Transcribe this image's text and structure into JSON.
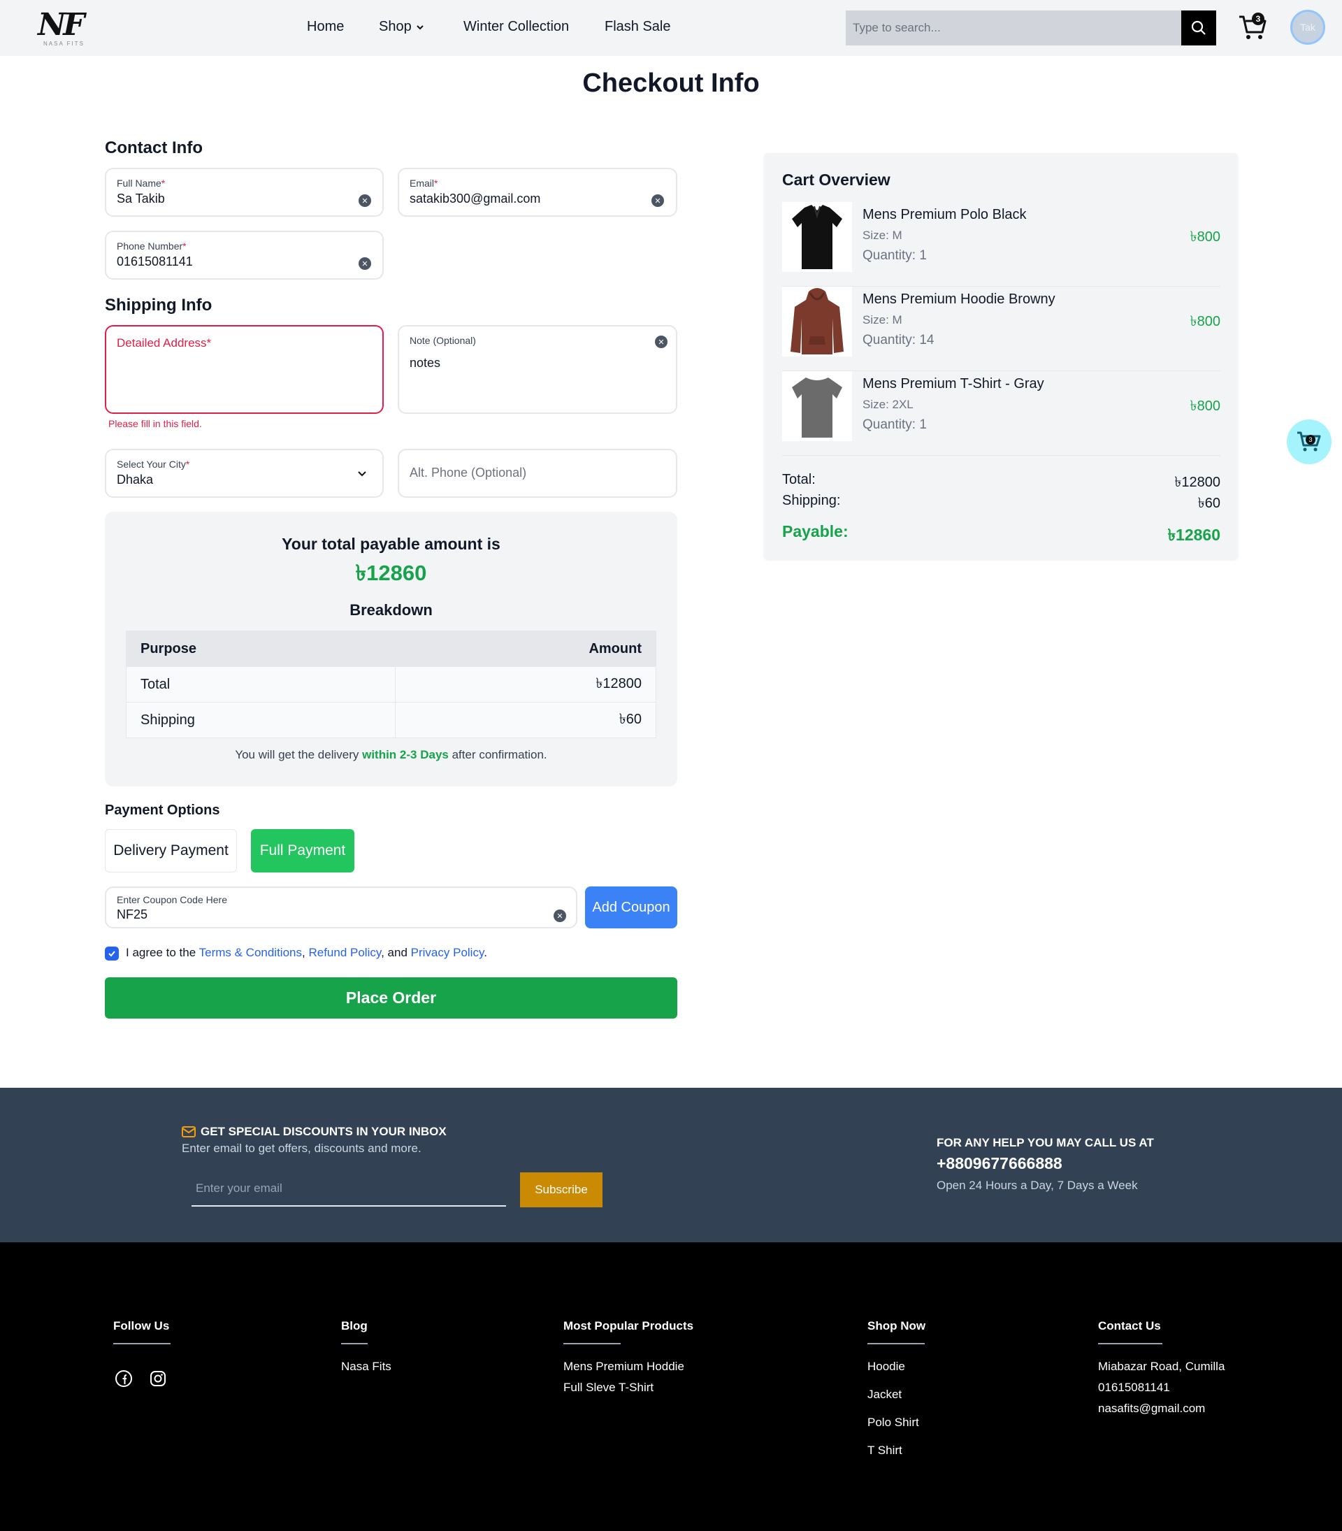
{
  "header": {
    "logo_text": "NF",
    "logo_subtext": "NASA FITS",
    "nav": [
      {
        "label": "Home"
      },
      {
        "label": "Shop"
      },
      {
        "label": "Winter Collection"
      },
      {
        "label": "Flash Sale"
      }
    ],
    "search_placeholder": "Type to search...",
    "cart_count": "3",
    "avatar_text": "Tak"
  },
  "page_title": "Checkout Info",
  "contact": {
    "title": "Contact Info",
    "full_name_label": "Full Name",
    "full_name_value": "Sa Takib",
    "email_label": "Email",
    "email_value": "satakib300@gmail.com",
    "phone_label": "Phone Number",
    "phone_value": "01615081141",
    "required_mark": "*"
  },
  "shipping": {
    "title": "Shipping Info",
    "address_label": "Detailed Address",
    "address_error": "Please fill in this field.",
    "note_label": "Note (Optional)",
    "note_value": "notes",
    "city_label": "Select Your City",
    "city_value": "Dhaka",
    "alt_phone_placeholder": "Alt. Phone (Optional)"
  },
  "summary": {
    "heading": "Your total payable amount is",
    "amount": "৳12860",
    "breakdown_title": "Breakdown",
    "col_purpose": "Purpose",
    "col_amount": "Amount",
    "rows": [
      {
        "purpose": "Total",
        "amount": "৳12800"
      },
      {
        "purpose": "Shipping",
        "amount": "৳60"
      }
    ],
    "delivery_prefix": "You will get the delivery",
    "delivery_highlight": "within 2-3 Days",
    "delivery_suffix": "after confirmation."
  },
  "payment": {
    "title": "Payment Options",
    "delivery_payment": "Delivery Payment",
    "full_payment": "Full Payment",
    "coupon_label": "Enter Coupon Code Here",
    "coupon_value": "NF25",
    "add_coupon": "Add Coupon"
  },
  "agreement": {
    "prefix": "I agree to the",
    "terms": "Terms & Conditions",
    "sep1": ",",
    "refund": "Refund Policy",
    "sep2": ", and",
    "privacy": "Privacy Policy",
    "end": "."
  },
  "place_order": "Place Order",
  "cart": {
    "title": "Cart Overview",
    "items": [
      {
        "name": "Mens Premium Polo Black",
        "size": "Size: M",
        "quantity": "Quantity: 1",
        "price": "৳800",
        "image": "black-polo-shirt",
        "color": "#111111"
      },
      {
        "name": "Mens Premium Hoodie Browny",
        "size": "Size: M",
        "quantity": "Quantity: 14",
        "price": "৳800",
        "image": "brown-hoodie",
        "color": "#7c3a2d"
      },
      {
        "name": "Mens Premium T-Shirt - Gray",
        "size": "Size: 2XL",
        "quantity": "Quantity: 1",
        "price": "৳800",
        "image": "gray-t-shirt",
        "color": "#6b6b6b"
      }
    ],
    "total_label": "Total:",
    "total_value": "৳12800",
    "shipping_label": "Shipping:",
    "shipping_value": "৳60",
    "payable_label": "Payable:",
    "payable_value": "৳12860"
  },
  "float_cart_count": "3",
  "newsletter": {
    "title": "GET SPECIAL DISCOUNTS IN YOUR INBOX",
    "subtitle": "Enter email to get offers, discounts and more.",
    "email_placeholder": "Enter your email",
    "subscribe": "Subscribe",
    "help_title": "FOR ANY HELP YOU MAY CALL US AT",
    "help_phone": "+8809677666888",
    "help_sub": "Open 24 Hours a Day, 7 Days a Week"
  },
  "footer": {
    "follow_us": "Follow Us",
    "blog": "Blog",
    "blog_links": [
      "Nasa Fits"
    ],
    "popular": "Most Popular Products",
    "popular_links": [
      "Mens Premium Hoddie",
      "Full Sleve T-Shirt"
    ],
    "shop_now": "Shop Now",
    "shop_links": [
      "Hoodie",
      "Jacket",
      "Polo Shirt",
      "T Shirt"
    ],
    "contact_us": "Contact Us",
    "contact_lines": [
      "Miabazar Road, Cumilla",
      "01615081141",
      "nasafits@gmail.com"
    ]
  },
  "colors": {
    "accent_green": "#16a34a",
    "button_green": "#22c55e",
    "coupon_blue": "#3b82f6",
    "error_pink": "#e11d48",
    "newsletter_bg": "#334155",
    "subscribe_gold": "#ca8a04"
  }
}
